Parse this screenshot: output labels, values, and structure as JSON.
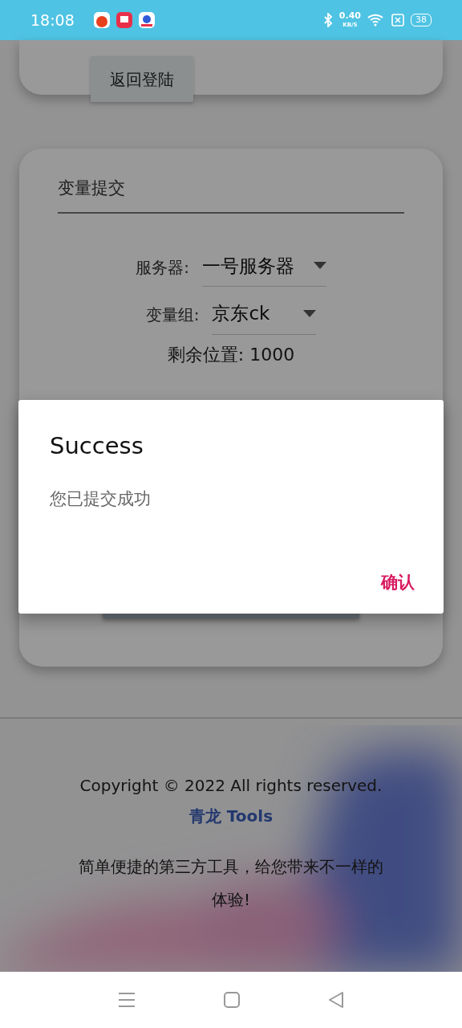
{
  "status_bar": {
    "time": "18:08",
    "net_speed": "0.40",
    "net_speed_unit": "KB/S",
    "battery": "38"
  },
  "top_card": {
    "button": "返回登陆"
  },
  "form": {
    "title_field": {
      "value": "变量提交"
    },
    "selects": [
      {
        "label": "服务器:",
        "value": "一号服务器"
      },
      {
        "label": "变量组:",
        "value": "京东ck"
      }
    ],
    "remaining": {
      "label": "剩余位置:",
      "value": "1000"
    }
  },
  "dialog": {
    "title": "Success",
    "message": "您已提交成功",
    "button": "确认"
  },
  "footer": {
    "copyright": "Copyright © 2022 All rights reserved.",
    "brand": "青龙 Tools",
    "tagline": "简单便捷的第三方工具，给您带来不一样的体验!"
  }
}
